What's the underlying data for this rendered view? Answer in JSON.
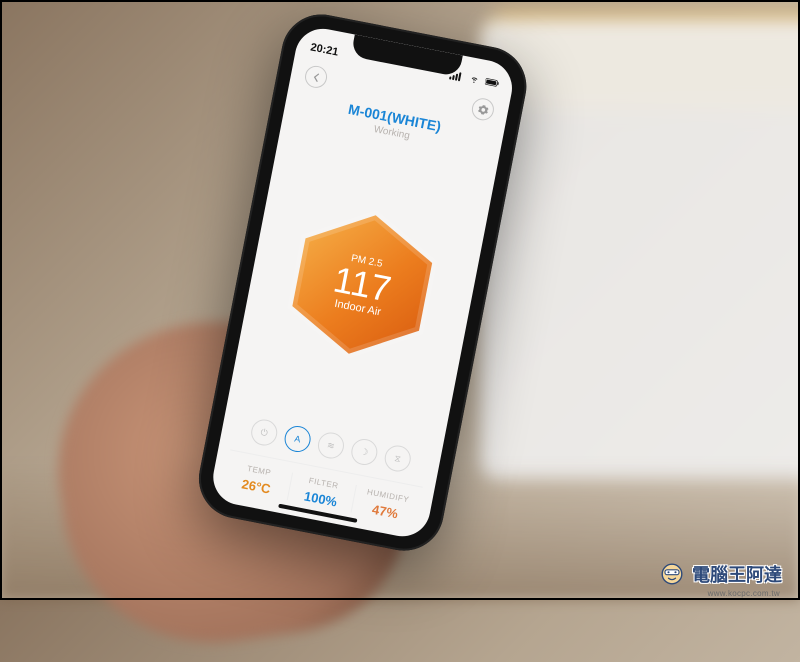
{
  "status": {
    "time": "20:21"
  },
  "device": {
    "name": "M-001(WHITE)",
    "status": "Working"
  },
  "reading": {
    "metric": "PM 2.5",
    "value": "117",
    "label": "Indoor Air"
  },
  "modes": {
    "power": "⏻",
    "auto": "A",
    "fan": "≋",
    "sleep": "☽",
    "timer": "⧖"
  },
  "stats": {
    "temp": {
      "label": "TEMP",
      "value": "26°C"
    },
    "filter": {
      "label": "FILTER",
      "value": "100%"
    },
    "humid": {
      "label": "HUMIDIFY",
      "value": "47%"
    }
  },
  "watermark": {
    "text": "電腦王阿達",
    "url": "www.kocpc.com.tw"
  }
}
